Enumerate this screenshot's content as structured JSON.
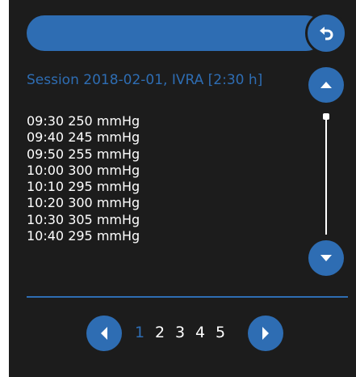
{
  "session": {
    "title": "Session  2018-02-01, IVRA [2:30 h]"
  },
  "readings": [
    "09:30  250 mmHg",
    "09:40  245 mmHg",
    "09:50  255 mmHg",
    "10:00  300 mmHg",
    "10:10  295 mmHg",
    "10:20  300 mmHg",
    "10:30  305 mmHg",
    "10:40  295 mmHg"
  ],
  "pagination": {
    "pages": [
      "1",
      "2",
      "3",
      "4",
      "5"
    ],
    "current": "1"
  },
  "icons": {
    "back": "undo-arrow-icon",
    "up": "triangle-up-icon",
    "down": "triangle-down-icon",
    "prev": "triangle-left-icon",
    "next": "triangle-right-icon"
  },
  "colors": {
    "accent": "#2e6db3",
    "background": "#1c1c1c",
    "text": "#ffffff"
  }
}
